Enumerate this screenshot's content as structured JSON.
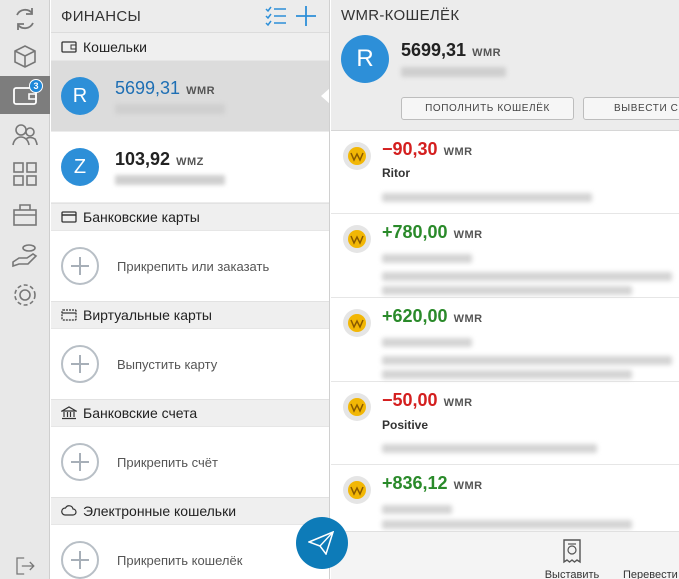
{
  "app": {
    "rail_badge_count": "3"
  },
  "rail": [
    {
      "name": "refresh-icon"
    },
    {
      "name": "box-icon"
    },
    {
      "name": "wallet-icon"
    },
    {
      "name": "people-icon"
    },
    {
      "name": "services-icon"
    },
    {
      "name": "shop-icon"
    },
    {
      "name": "hand-coin-icon"
    },
    {
      "name": "settings-icon"
    },
    {
      "name": "logout-icon"
    }
  ],
  "finance": {
    "title": "ФИНАНСЫ",
    "wallets_header": "Кошельки",
    "wallets": [
      {
        "letter": "R",
        "amount": "5699,31",
        "currency": "WMR"
      },
      {
        "letter": "Z",
        "amount": "103,92",
        "currency": "WMZ"
      }
    ],
    "bank_cards": {
      "header": "Банковские карты",
      "action": "Прикрепить или заказать"
    },
    "virtual_cards": {
      "header": "Виртуальные карты",
      "action": "Выпустить карту"
    },
    "bank_accounts": {
      "header": "Банковские счета",
      "action": "Прикрепить счёт"
    },
    "e_wallets": {
      "header": "Электронные кошельки",
      "action": "Прикрепить кошелёк"
    }
  },
  "wallet_panel": {
    "title": "WMR-КОШЕЛЁК",
    "letter": "R",
    "amount": "5699,31",
    "currency": "WMR",
    "topup_button": "ПОПОЛНИТЬ КОШЕЛЁК",
    "withdraw_button": "ВЫВЕСТИ СР",
    "transactions": [
      {
        "amount": "−90,30",
        "currency": "WMR",
        "sign": "neg",
        "name": "Ritor"
      },
      {
        "amount": "+780,00",
        "currency": "WMR",
        "sign": "pos",
        "name": ""
      },
      {
        "amount": "+620,00",
        "currency": "WMR",
        "sign": "pos",
        "name": ""
      },
      {
        "amount": "−50,00",
        "currency": "WMR",
        "sign": "neg",
        "name": "Positive"
      },
      {
        "amount": "+836,12",
        "currency": "WMR",
        "sign": "pos",
        "name": ""
      }
    ]
  },
  "bottom_bar": {
    "invoice_label": "Выставить",
    "transfer_label": "Перевести"
  },
  "colors": {
    "accent": "#2d8fd8",
    "negative": "#d41f1f",
    "positive": "#2a8a2a",
    "send_button": "#0d7bb8"
  }
}
